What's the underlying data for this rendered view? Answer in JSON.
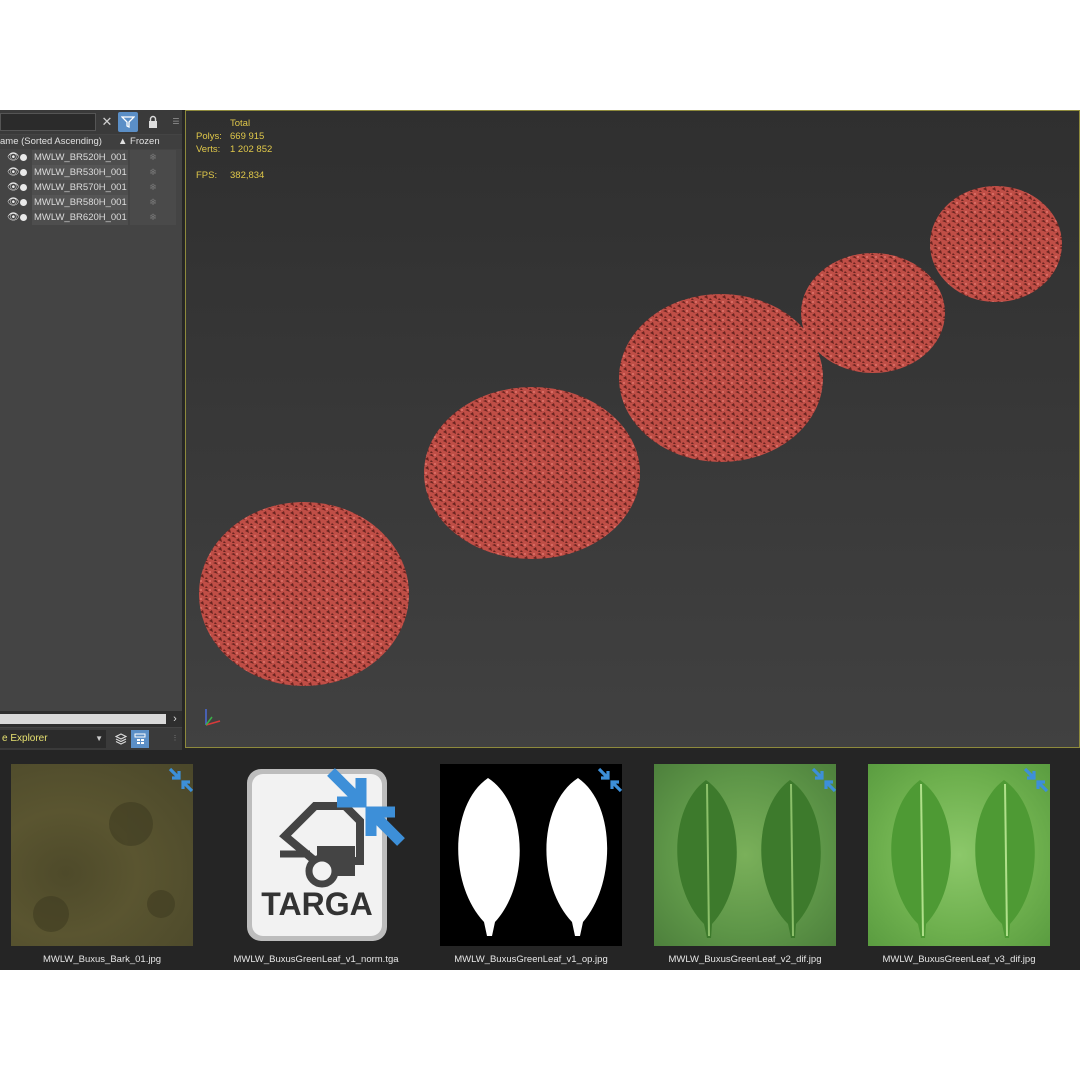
{
  "explorer": {
    "header_name": "ame (Sorted Ascending)",
    "header_frozen": "▲ Frozen",
    "rows": [
      {
        "name": "MWLW_BR520H_001"
      },
      {
        "name": "MWLW_BR530H_001"
      },
      {
        "name": "MWLW_BR570H_001"
      },
      {
        "name": "MWLW_BR580H_001"
      },
      {
        "name": "MWLW_BR620H_001"
      }
    ],
    "bottom_select": "e Explorer"
  },
  "viewport": {
    "stats": {
      "header": "Total",
      "polys_label": "Polys:",
      "polys_value": "669 915",
      "verts_label": "Verts:",
      "verts_value": "1 202 852",
      "fps_label": "FPS:",
      "fps_value": "382,834"
    },
    "foliage_color": "#c8524a"
  },
  "textures": [
    {
      "label": "MWLW_Buxus_Bark_01.jpg"
    },
    {
      "label": "MWLW_BuxusGreenLeaf_v1_norm.tga",
      "targa_text": "TARGA"
    },
    {
      "label": "MWLW_BuxusGreenLeaf_v1_op.jpg"
    },
    {
      "label": "MWLW_BuxusGreenLeaf_v2_dif.jpg"
    },
    {
      "label": "MWLW_BuxusGreenLeaf_v3_dif.jpg"
    }
  ],
  "colors": {
    "accent_blue": "#3d8fd8",
    "stats_yellow": "#e0c84a",
    "viewport_border": "#8e8a3c"
  }
}
